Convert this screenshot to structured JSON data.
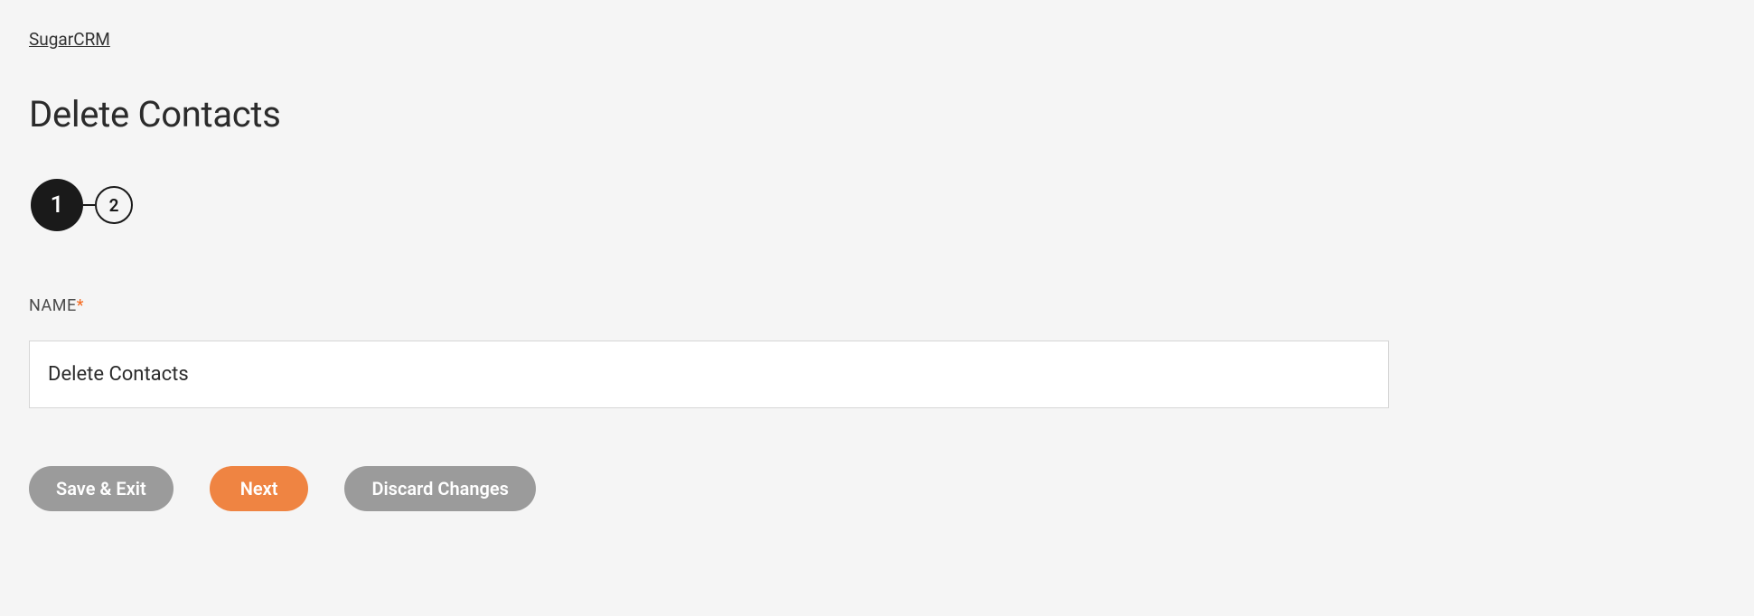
{
  "breadcrumb": {
    "link_text": "SugarCRM"
  },
  "page": {
    "title": "Delete Contacts"
  },
  "wizard": {
    "steps": [
      "1",
      "2"
    ],
    "active_index": 0
  },
  "form": {
    "name_label": "NAME",
    "required_marker": "*",
    "name_value": "Delete Contacts"
  },
  "buttons": {
    "save_exit": "Save & Exit",
    "next": "Next",
    "discard": "Discard Changes"
  }
}
